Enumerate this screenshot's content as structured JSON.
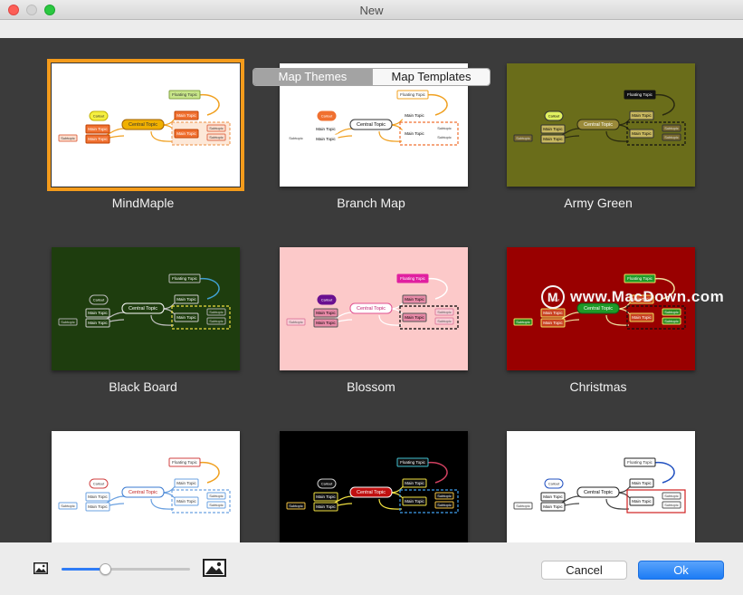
{
  "window": {
    "title": "New"
  },
  "tabs": [
    {
      "label": "Map Themes",
      "active": true
    },
    {
      "label": "Map Templates",
      "active": false
    }
  ],
  "themes": [
    {
      "name": "MindMaple",
      "selected": true
    },
    {
      "name": "Branch Map",
      "selected": false
    },
    {
      "name": "Army Green",
      "selected": false
    },
    {
      "name": "Black Board",
      "selected": false
    },
    {
      "name": "Blossom",
      "selected": false
    },
    {
      "name": "Christmas",
      "selected": false
    },
    {
      "name": "",
      "selected": false
    },
    {
      "name": "",
      "selected": false
    },
    {
      "name": "",
      "selected": false
    }
  ],
  "thumbnail_text": {
    "floating": "Floating Topic",
    "callout": "Callout",
    "central": "Central Topic",
    "main": "Main Topic",
    "subtopic": "Subtopic"
  },
  "watermark": {
    "logo": "M",
    "text": "www.MacDown.com"
  },
  "bottom": {
    "zoom_level": 0.34,
    "cancel_label": "Cancel",
    "ok_label": "Ok"
  }
}
